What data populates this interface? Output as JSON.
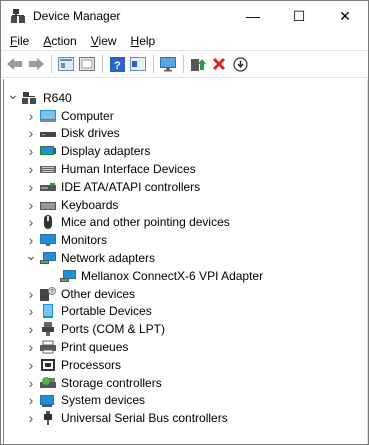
{
  "window": {
    "title": "Device Manager",
    "min_glyph": "—",
    "max_glyph": "☐",
    "close_glyph": "✕"
  },
  "menu": [
    {
      "label": "File",
      "key": "F",
      "rest": "ile"
    },
    {
      "label": "Action",
      "key": "A",
      "rest": "ction"
    },
    {
      "label": "View",
      "key": "V",
      "rest": "iew"
    },
    {
      "label": "Help",
      "key": "H",
      "rest": "elp"
    }
  ],
  "toolbar": [
    "back-icon",
    "forward-icon",
    "properties-icon",
    "scan-icon",
    "help-icon",
    "view-icon",
    "monitor-icon",
    "update-driver-icon",
    "uninstall-icon",
    "disable-icon"
  ],
  "tree": {
    "root": {
      "label": "R640",
      "icon": "computer-root-icon",
      "expanded": true
    },
    "categories": [
      {
        "label": "Computer",
        "icon": "computer-icon",
        "expanded": false
      },
      {
        "label": "Disk drives",
        "icon": "disk-icon",
        "expanded": false
      },
      {
        "label": "Display adapters",
        "icon": "display-icon",
        "expanded": false
      },
      {
        "label": "Human Interface Devices",
        "icon": "hid-icon",
        "expanded": false
      },
      {
        "label": "IDE ATA/ATAPI controllers",
        "icon": "ide-icon",
        "expanded": false
      },
      {
        "label": "Keyboards",
        "icon": "keyboard-icon",
        "expanded": false
      },
      {
        "label": "Mice and other pointing devices",
        "icon": "mouse-icon",
        "expanded": false
      },
      {
        "label": "Monitors",
        "icon": "monitor-icon",
        "expanded": false
      },
      {
        "label": "Network adapters",
        "icon": "network-icon",
        "expanded": true,
        "children": [
          {
            "label": "Mellanox ConnectX-6 VPI Adapter",
            "icon": "network-icon"
          }
        ]
      },
      {
        "label": "Other devices",
        "icon": "other-icon",
        "expanded": false
      },
      {
        "label": "Portable Devices",
        "icon": "portable-icon",
        "expanded": false
      },
      {
        "label": "Ports (COM & LPT)",
        "icon": "port-icon",
        "expanded": false
      },
      {
        "label": "Print queues",
        "icon": "printer-icon",
        "expanded": false
      },
      {
        "label": "Processors",
        "icon": "processor-icon",
        "expanded": false
      },
      {
        "label": "Storage controllers",
        "icon": "storage-icon",
        "expanded": false
      },
      {
        "label": "System devices",
        "icon": "system-icon",
        "expanded": false
      },
      {
        "label": "Universal Serial Bus controllers",
        "icon": "usb-icon",
        "expanded": false
      }
    ]
  },
  "colors": {
    "accent": "#1e90d6",
    "uninstall": "#e0201b",
    "update": "#2e9a3a"
  }
}
